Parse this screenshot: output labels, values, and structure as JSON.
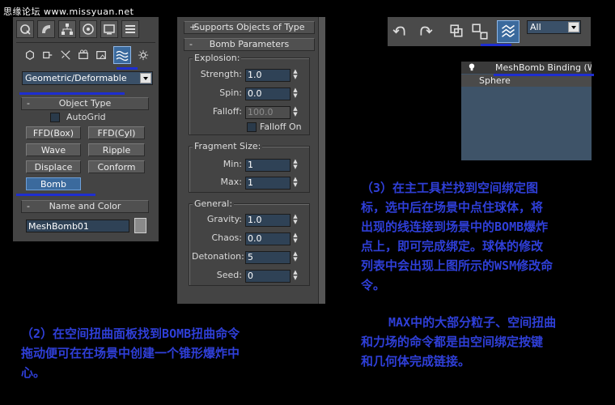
{
  "watermark": "思缘论坛 www.missyuan.net",
  "create_panel": {
    "dropdown_value": "Geometric/Deformable",
    "object_type": {
      "title": "Object Type",
      "autogrid_label": "AutoGrid",
      "buttons": [
        "FFD(Box)",
        "FFD(Cyl)",
        "Wave",
        "Ripple",
        "Displace",
        "Conform",
        "Bomb"
      ]
    },
    "name_color": {
      "title": "Name and Color",
      "name_value": "MeshBomb01"
    },
    "top_icons": [
      "create-icon",
      "modify-icon",
      "hierarchy-icon",
      "motion-icon",
      "display-icon",
      "utilities-icon"
    ],
    "category_icons": [
      "geometry-icon",
      "shapes-icon",
      "lights-icon",
      "cameras-icon",
      "helpers-icon",
      "space-warps-icon",
      "systems-icon"
    ]
  },
  "params_panel": {
    "rollout_supports": "Supports Objects of Type",
    "rollout_params": "Bomb Parameters",
    "explosion": {
      "label": "Explosion:",
      "strength": {
        "label": "Strength:",
        "value": "1.0"
      },
      "spin": {
        "label": "Spin:",
        "value": "0.0"
      },
      "falloff": {
        "label": "Falloff:",
        "value": "100.0"
      },
      "falloff_on": "Falloff On"
    },
    "fragment": {
      "label": "Fragment Size:",
      "min": {
        "label": "Min:",
        "value": "1"
      },
      "max": {
        "label": "Max:",
        "value": "1"
      }
    },
    "general": {
      "label": "General:",
      "gravity": {
        "label": "Gravity:",
        "value": "1.0"
      },
      "chaos": {
        "label": "Chaos:",
        "value": "0.0"
      },
      "detonation": {
        "label": "Detonation:",
        "value": "5"
      },
      "seed": {
        "label": "Seed:",
        "value": "0"
      }
    }
  },
  "toolbar": {
    "select_value": "All",
    "icons": [
      "undo-icon",
      "redo-icon",
      "select-link-icon",
      "unlink-icon",
      "bind-space-warp-icon"
    ]
  },
  "modifier_stack": {
    "items": [
      "MeshBomb Binding (WSM",
      "Sphere"
    ]
  },
  "notes": {
    "step3_lines": [
      "（3）在主工具栏找到空间绑定图",
      "标，选中后在场景中点住球体，将",
      "出现的线连接到场景中的BOMB爆炸",
      "点上，即可完成绑定。球体的修改",
      "列表中会出现上图所示的WSM修改命",
      "令。"
    ],
    "max_lines": [
      "MAX中的大部分粒子、空间扭曲",
      "和力场的命令都是由空间绑定按键",
      "和几何体完成链接。"
    ],
    "step2_lines": [
      "（2）在空间扭曲面板找到BOMB扭曲命令",
      "拖动便可在在场景中创建一个锥形爆炸中",
      "心。"
    ]
  },
  "colors": {
    "accent_blue": "#1e2ed0",
    "note_text": "#2f3fd8",
    "active_button": "#3b6a9d"
  }
}
